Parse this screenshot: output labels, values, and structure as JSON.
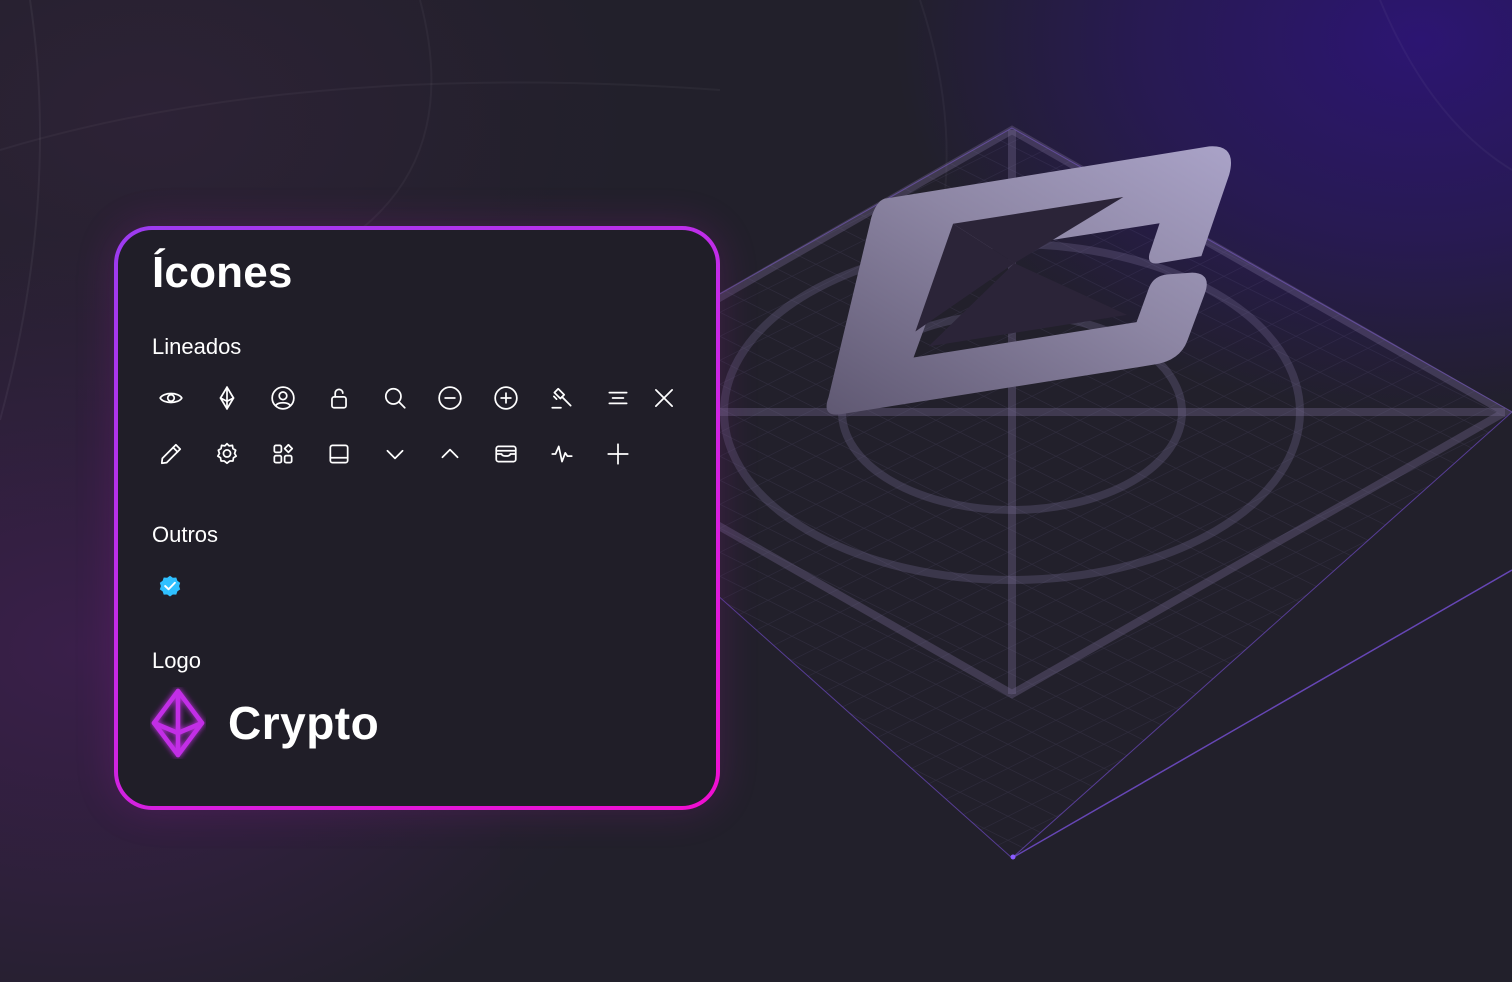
{
  "card": {
    "title": "Ícones",
    "sections": {
      "lined": "Lineados",
      "others": "Outros",
      "logo": "Logo"
    },
    "lined_icons_row1": [
      "eye-icon",
      "diamond-icon",
      "user-circle-icon",
      "unlock-icon",
      "search-icon",
      "minus-circle-icon",
      "plus-circle-icon",
      "gavel-icon",
      "align-center-icon",
      "close-icon"
    ],
    "lined_icons_row2": [
      "pencil-icon",
      "gear-icon",
      "widgets-icon",
      "panel-bottom-icon",
      "chevron-down-icon",
      "chevron-up-icon",
      "wallet-icon",
      "activity-icon",
      "plus-icon"
    ],
    "other_icons": [
      "verified-badge-icon"
    ],
    "logo": {
      "name": "Crypto",
      "mark": "crypto-diamond-logo"
    }
  },
  "colors": {
    "background": "#22202b",
    "card_background": "#201e28",
    "border_gradient_start": "#9b3cf0",
    "border_gradient_end": "#f00ed0",
    "badge": "#2fc0ff",
    "logo_accent": "#c22fe6"
  }
}
